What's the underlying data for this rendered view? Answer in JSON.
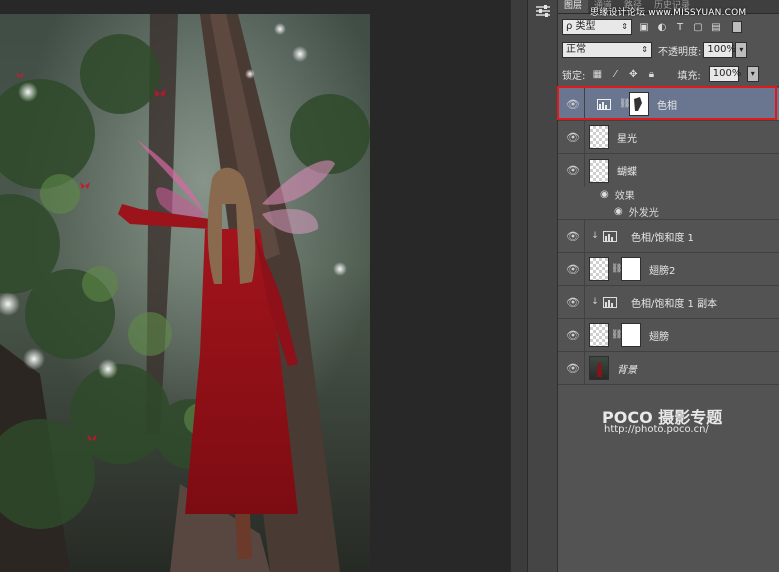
{
  "panel": {
    "tabs": [
      {
        "label": "图层"
      },
      {
        "label": "通道"
      },
      {
        "label": "路径"
      },
      {
        "label": "历史记录"
      }
    ],
    "top_watermark": "思缘设计论坛 www.MISSYUAN.COM",
    "filter_label": "ρ 类型",
    "blend_mode": "正常",
    "opacity_label": "不透明度:",
    "opacity_value": "100%",
    "lock_label": "锁定:",
    "fill_label": "填充:",
    "fill_value": "100%"
  },
  "layers": [
    {
      "name": "色相",
      "type": "adjustment-masked",
      "selected": true
    },
    {
      "name": "星光",
      "type": "pixel"
    },
    {
      "name": "蝴蝶",
      "type": "pixel",
      "effects_label": "效果",
      "effect_item": "外发光"
    },
    {
      "name": "色相/饱和度 1",
      "type": "adjustment",
      "clipped": true
    },
    {
      "name": "翅膀2",
      "type": "pixel-masked"
    },
    {
      "name": "色相/饱和度 1 副本",
      "type": "adjustment",
      "clipped": true
    },
    {
      "name": "翅膀",
      "type": "pixel-masked"
    },
    {
      "name": "背景",
      "type": "background"
    }
  ],
  "watermark": {
    "brand": "POCO 摄影专题",
    "url": "http://photo.poco.cn/"
  },
  "colors": {
    "selection_highlight": "#6a7690",
    "selection_frame": "#e01a1a",
    "panel_bg": "#535353"
  }
}
